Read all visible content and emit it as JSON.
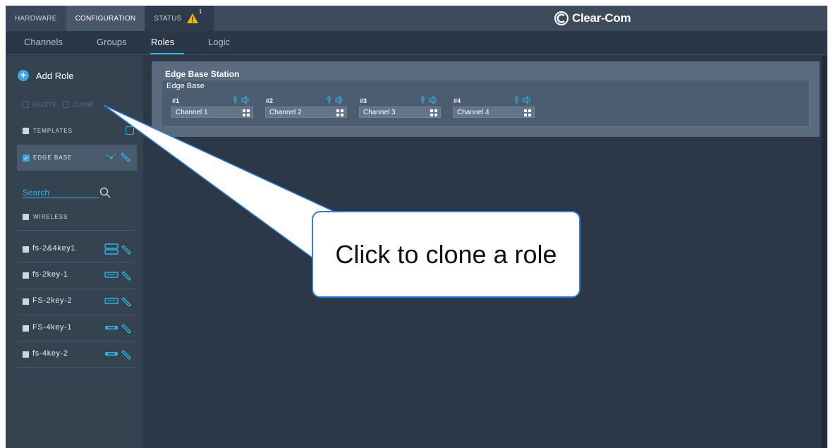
{
  "topnav": {
    "tabs": [
      {
        "label": "HARDWARE"
      },
      {
        "label": "CONFIGURATION"
      },
      {
        "label": "STATUS"
      }
    ],
    "status_count": "1",
    "brand": "Clear-Com"
  },
  "subnav": {
    "tabs": [
      {
        "label": "Channels"
      },
      {
        "label": "Groups"
      },
      {
        "label": "Roles"
      },
      {
        "label": "Logic"
      }
    ]
  },
  "sidebar": {
    "add_role": "Add Role",
    "delete": "DELETE",
    "clone": "CLONE",
    "templates": "TEMPLATES",
    "edge_base": "EDGE BASE",
    "search_placeholder": "Search",
    "wireless": "WIRELESS",
    "devices": [
      {
        "name": "fs-2&4key1"
      },
      {
        "name": "fs-2key-1"
      },
      {
        "name": "FS-2key-2"
      },
      {
        "name": "FS-4key-1"
      },
      {
        "name": "fs-4key-2"
      }
    ]
  },
  "main": {
    "card_title": "Edge Base Station",
    "inner_title": "Edge Base",
    "channels": [
      {
        "num": "#1",
        "label": "Channel 1"
      },
      {
        "num": "#2",
        "label": "Channel 2"
      },
      {
        "num": "#3",
        "label": "Channel 3"
      },
      {
        "num": "#4",
        "label": "Channel 4"
      }
    ]
  },
  "callout": {
    "text": "Click to clone a role"
  },
  "colors": {
    "accent": "#2fb4e8",
    "warning": "#f2b705",
    "background": "#2c3848"
  }
}
